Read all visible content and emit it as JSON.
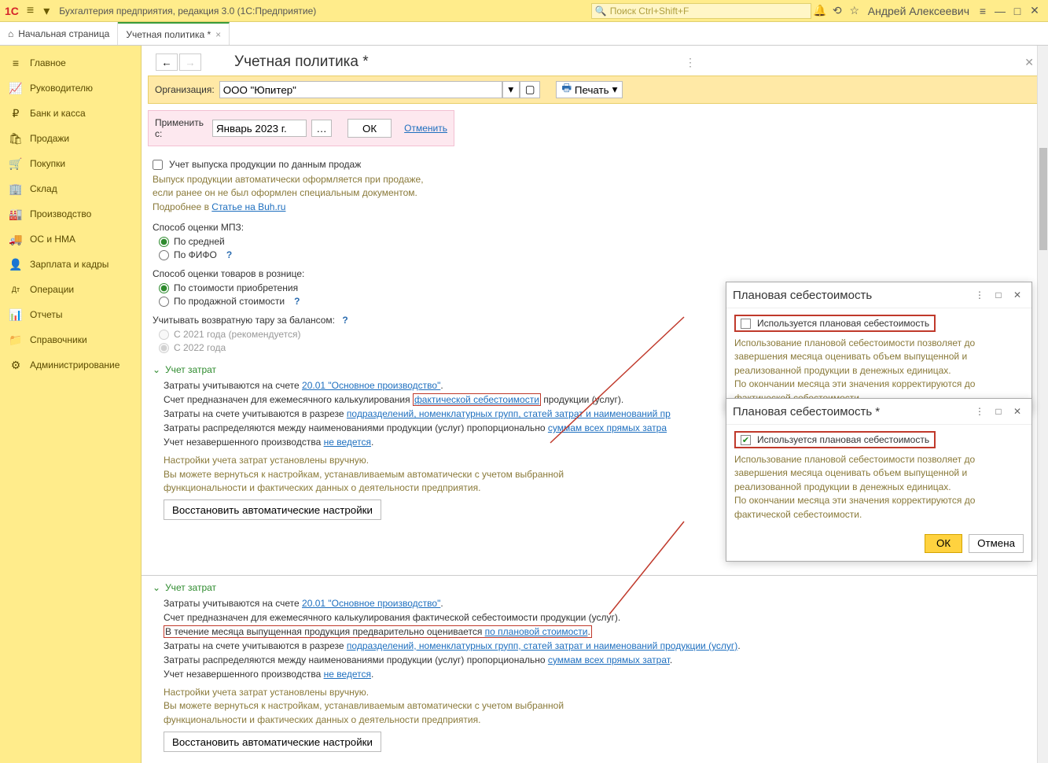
{
  "titlebar": {
    "app_title": "Бухгалтерия предприятия, редакция 3.0  (1С:Предприятие)",
    "search_placeholder": "Поиск Ctrl+Shift+F",
    "user": "Андрей Алексеевич"
  },
  "tabs": {
    "home": "Начальная страница",
    "active": "Учетная политика *"
  },
  "sidebar": [
    {
      "icon": "≡",
      "label": "Главное"
    },
    {
      "icon": "📈",
      "label": "Руководителю"
    },
    {
      "icon": "₽",
      "label": "Банк и касса"
    },
    {
      "icon": "🛍",
      "label": "Продажи"
    },
    {
      "icon": "🛒",
      "label": "Покупки"
    },
    {
      "icon": "🏢",
      "label": "Склад"
    },
    {
      "icon": "🏭",
      "label": "Производство"
    },
    {
      "icon": "🚚",
      "label": "ОС и НМА"
    },
    {
      "icon": "👤",
      "label": "Зарплата и кадры"
    },
    {
      "icon": "Дт",
      "label": "Операции"
    },
    {
      "icon": "📊",
      "label": "Отчеты"
    },
    {
      "icon": "📁",
      "label": "Справочники"
    },
    {
      "icon": "⚙",
      "label": "Администрирование"
    }
  ],
  "page": {
    "title": "Учетная политика *",
    "org_label": "Организация:",
    "org_value": "ООО \"Юпитер\"",
    "print": "Печать",
    "apply_label": "Применить с:",
    "apply_value": "Январь 2023 г.",
    "ok": "ОК",
    "cancel": "Отменить"
  },
  "form": {
    "checkbox1": "Учет выпуска продукции по данным продаж",
    "hint1a": "Выпуск продукции автоматически оформляется при продаже,",
    "hint1b": "если ранее он не был оформлен специальным документом.",
    "hint1c": "Подробнее в ",
    "hint1_link": "Статье на Buh.ru",
    "mpz_label": "Способ оценки МПЗ:",
    "mpz_opt1": "По средней",
    "mpz_opt2": "По ФИФО",
    "retail_label": "Способ оценки товаров в рознице:",
    "retail_opt1": "По стоимости приобретения",
    "retail_opt2": "По продажной стоимости",
    "tara_label": "Учитывать возвратную тару за балансом:",
    "tara_opt1": "С 2021 года (рекомендуется)",
    "tara_opt2": "С 2022 года",
    "cost_header": "Учет затрат",
    "cost_l1a": "Затраты учитываются на счете ",
    "cost_l1_link": "20.01 \"Основное производство\"",
    "cost_l1b": ".",
    "cost_l2a": "Счет предназначен для ежемесячного калькулирования ",
    "cost_l2_link": "фактической себестоимости",
    "cost_l2b": " продукции (услуг).",
    "cost_l3a": "Затраты на счете учитываются в разрезе ",
    "cost_l3_link": "подразделений, номенклатурных групп, статей затрат и наименований пр",
    "cost_l4a": "Затраты распределяются между наименованиями продукции (услуг) пропорционально ",
    "cost_l4_link": "суммам всех прямых затра",
    "cost_l5a": "Учет незавершенного производства ",
    "cost_l5_link": "не ведется",
    "cost_l5b": ".",
    "cost_h1": "Настройки учета затрат установлены вручную.",
    "cost_h2": "Вы можете вернуться к настройкам, устанавливаемым автоматически с учетом выбранной",
    "cost_h3": "функциональности и фактических данных о деятельности предприятия.",
    "restore_btn": "Восстановить автоматические настройки",
    "cost2_l2": "Счет предназначен для ежемесячного калькулирования фактической себестоимости продукции (услуг).",
    "cost2_plan_a": "В течение месяца выпущенная продукция предварительно оценивается ",
    "cost2_plan_link": "по плановой стоимости",
    "cost2_plan_b": ".",
    "cost2_l3_link": "подразделений, номенклатурных групп, статей затрат и наименований продукции (услуг)",
    "cost2_l4_link": "суммам всех прямых затрат"
  },
  "popup": {
    "title1": "Плановая себестоимость",
    "title2": "Плановая себестоимость *",
    "checkbox": "Используется плановая себестоимость",
    "desc1": "Использование плановой себестоимости позволяет до завершения месяца оценивать объем выпущенной и реализованной продукции в денежных единицах.",
    "desc2": "По окончании месяца эти значения корректируются до фактической себестоимости.",
    "ok": "ОК",
    "cancel": "Отмена"
  }
}
